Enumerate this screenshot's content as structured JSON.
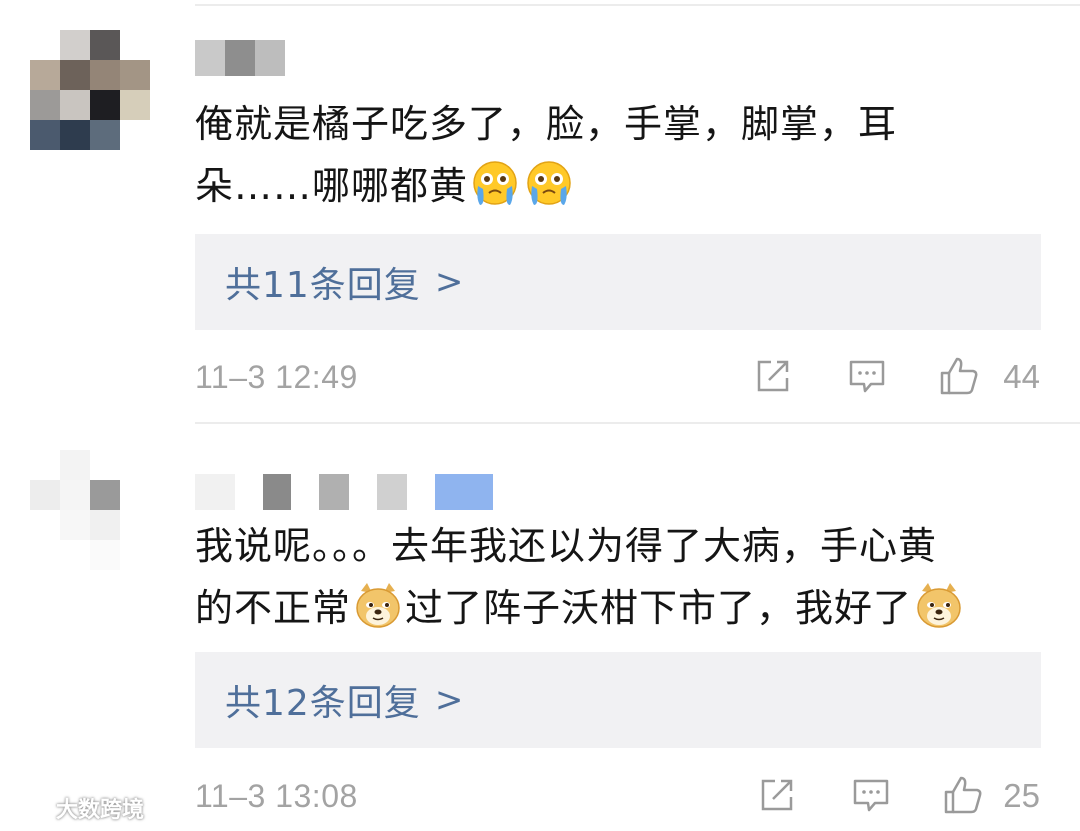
{
  "comments": [
    {
      "text_line1": "俺就是橘子吃多了，脸，手掌，脚掌，耳",
      "text_line2_pre": "朵……哪哪都黄",
      "emoji_name": "crying-face",
      "reply_label": "共11条回复",
      "reply_chevron": ">",
      "timestamp": "11–3 12:49",
      "likes": "44"
    },
    {
      "text_line1": "我说呢。。。去年我还以为得了大病，手心黄",
      "text_line2_a": "的不正常",
      "text_line2_b": "过了阵子沃柑下市了，我好了",
      "emoji_name": "doge",
      "reply_label": "共12条回复",
      "reply_chevron": ">",
      "timestamp": "11–3 13:08",
      "likes": "25"
    }
  ],
  "watermark": {
    "text": "大数跨境"
  },
  "colors": {
    "reply_link": "#4f6f9a",
    "reply_bg": "#f1f1f3",
    "meta_text": "#a3a3a3",
    "username_highlight": "#8fb4ef"
  }
}
